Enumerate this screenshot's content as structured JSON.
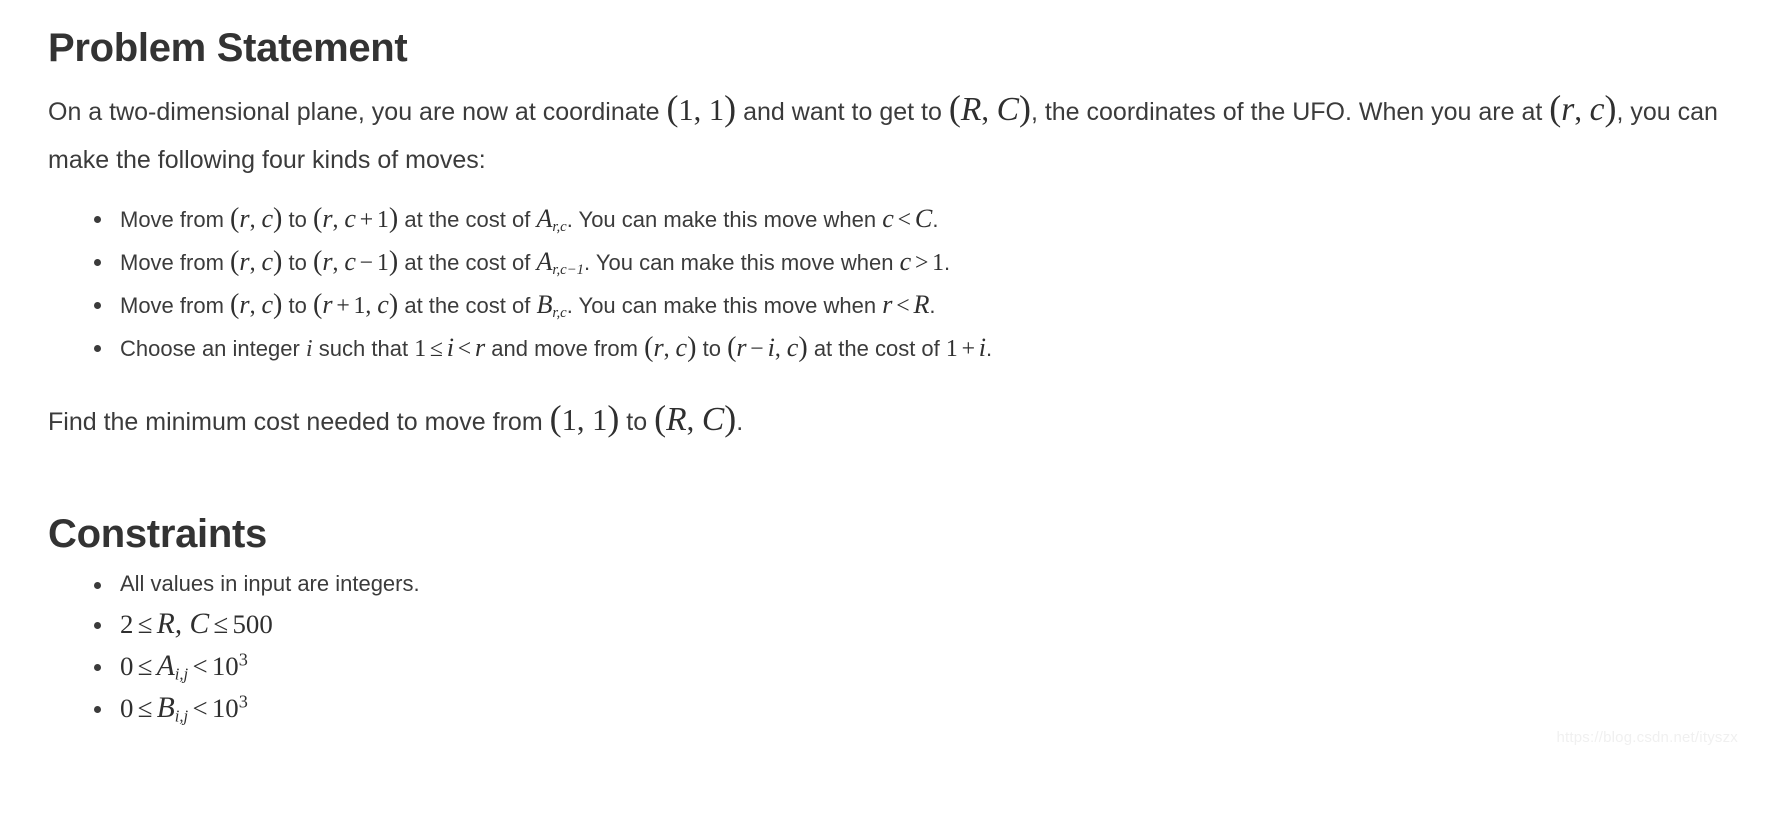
{
  "document": {
    "sections": [
      {
        "id": "problem-statement",
        "title": "Problem Statement"
      },
      {
        "id": "constraints",
        "title": "Constraints"
      }
    ]
  },
  "problem_statement": {
    "title": "Problem Statement",
    "intro_line1_part1": "On a two-dimensional plane, you are now at coordinate",
    "intro_line1_math1": "(1, 1)",
    "intro_line1_part2": "and want to get to",
    "intro_line1_math2": "(R, C)",
    "intro_line1_part3": ", the coordinates of the UFO.",
    "intro_line2_part1": "When you are at",
    "intro_line2_math1": "(r, c)",
    "intro_line2_part2": ", you can make the following four kinds of moves:",
    "moves": [
      {
        "text_1": "Move from",
        "math_from": "(r, c)",
        "text_2": "to",
        "math_to": "(r, c + 1)",
        "text_3": "at the cost of",
        "math_cost": "A",
        "math_cost_sub": "r,c",
        "text_4": ". You can make this move when",
        "math_cond_left": "c",
        "math_cond_op": "<",
        "math_cond_right": "C",
        "text_5": "."
      },
      {
        "text_1": "Move from",
        "math_from": "(r, c)",
        "text_2": "to",
        "math_to": "(r, c − 1)",
        "text_3": "at the cost of",
        "math_cost": "A",
        "math_cost_sub": "r,c−1",
        "text_4": ". You can make this move when",
        "math_cond_left": "c",
        "math_cond_op": ">",
        "math_cond_right": "1",
        "text_5": "."
      },
      {
        "text_1": "Move from",
        "math_from": "(r, c)",
        "text_2": "to",
        "math_to": "(r + 1, c)",
        "text_3": "at the cost of",
        "math_cost": "B",
        "math_cost_sub": "r,c",
        "text_4": ". You can make this move when",
        "math_cond_left": "r",
        "math_cond_op": "<",
        "math_cond_right": "R",
        "text_5": "."
      }
    ],
    "move_four": {
      "text_1": "Choose an integer",
      "math_i": "i",
      "text_2": "such that",
      "math_range": "1 ≤ i < r",
      "text_3": "and move from",
      "math_from": "(r, c)",
      "text_4": "to",
      "math_to": "(r − i, c)",
      "text_5": "at the cost of",
      "math_cost": "1 + i",
      "text_6": "."
    },
    "closing_part1": "Find the minimum cost needed to move from",
    "closing_math1": "(1, 1)",
    "closing_part2": "to",
    "closing_math2": "(R, C)",
    "closing_part3": "."
  },
  "constraints": {
    "title": "Constraints",
    "items": [
      {
        "kind": "text",
        "text": "All values in input are integers."
      },
      {
        "kind": "math",
        "lhs": "2",
        "op1": "≤",
        "mid": "R, C",
        "op2": "≤",
        "rhs": "500"
      },
      {
        "kind": "math_pow",
        "lhs": "0",
        "op1": "≤",
        "var": "A",
        "sub": "i,j",
        "op2": "<",
        "base": "10",
        "exp": "3"
      },
      {
        "kind": "math_pow",
        "lhs": "0",
        "op1": "≤",
        "var": "B",
        "sub": "i,j",
        "op2": "<",
        "base": "10",
        "exp": "3"
      }
    ]
  },
  "watermark": {
    "text": "https://blog.csdn.net/ityszx"
  },
  "colors": {
    "text": "#3b3b3b",
    "heading": "#333333",
    "background": "#ffffff",
    "watermark": "#f0f0f0"
  }
}
